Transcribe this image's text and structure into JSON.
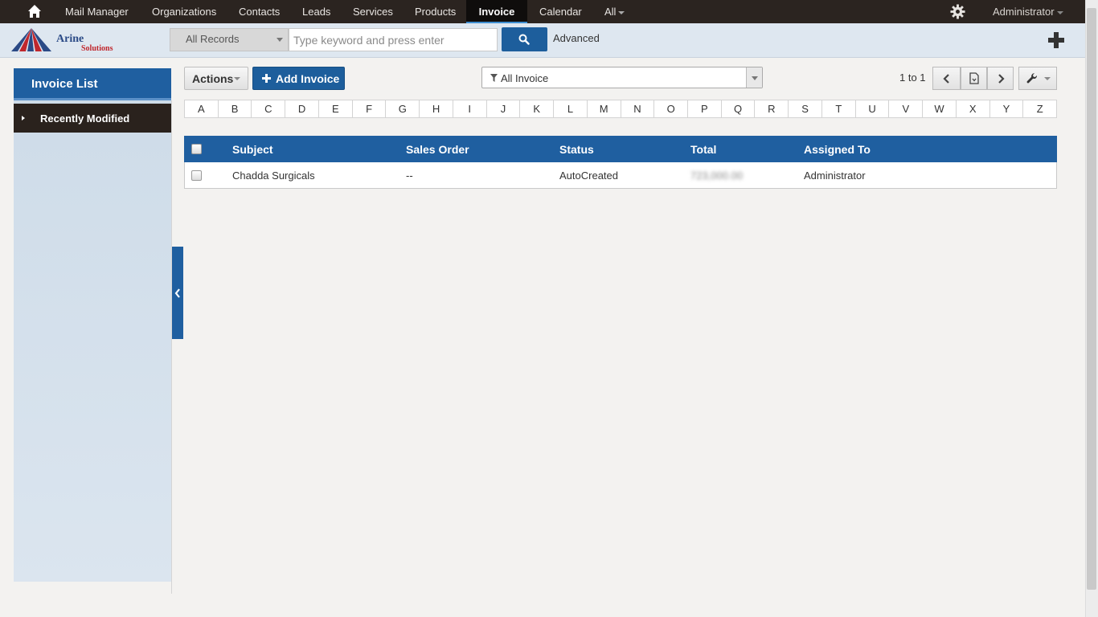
{
  "nav": {
    "items": [
      "Mail Manager",
      "Organizations",
      "Contacts",
      "Leads",
      "Services",
      "Products",
      "Invoice",
      "Calendar",
      "All"
    ],
    "active": "Invoice",
    "user": "Administrator"
  },
  "header": {
    "logo_text": "Arine",
    "logo_sub": "Solutions",
    "search_scope": "All Records",
    "search_placeholder": "Type keyword and press enter",
    "advanced_label": "Advanced"
  },
  "sidebar": {
    "title": "Invoice List",
    "items": [
      "Recently Modified"
    ]
  },
  "toolbar": {
    "actions_label": "Actions",
    "add_label": "Add Invoice",
    "filter_value": "All Invoice",
    "page_info": "1 to 1"
  },
  "alphabet": [
    "A",
    "B",
    "C",
    "D",
    "E",
    "F",
    "G",
    "H",
    "I",
    "J",
    "K",
    "L",
    "M",
    "N",
    "O",
    "P",
    "Q",
    "R",
    "S",
    "T",
    "U",
    "V",
    "W",
    "X",
    "Y",
    "Z"
  ],
  "table": {
    "columns": [
      "Subject",
      "Sales Order",
      "Status",
      "Total",
      "Assigned To"
    ],
    "rows": [
      [
        "Chadda Surgicals",
        "--",
        "AutoCreated",
        "723,000.00",
        "Administrator"
      ]
    ]
  },
  "colors": {
    "accent": "#1f5fa0",
    "nav_bg": "#2b2420"
  }
}
